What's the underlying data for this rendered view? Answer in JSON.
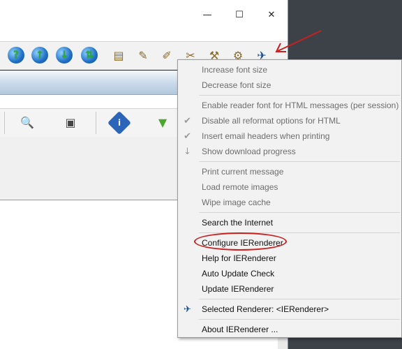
{
  "titlebar": {
    "minimize_glyph": "—",
    "maximize_glyph": "☐",
    "close_glyph": "✕"
  },
  "toolbar": {
    "globe_icons": [
      "globe-help-icon",
      "globe-up-icon",
      "globe-down-icon",
      "globe-sync-icon"
    ],
    "tool_icons": [
      "notes-icon",
      "edit-doc-icon",
      "doc-pen-icon",
      "wrench-scissors-icon",
      "tools-icon",
      "gear-tool-icon",
      "ierenderer-icon"
    ]
  },
  "toolbar_second": {
    "icons": [
      "search-doc-icon",
      "save-disk-icon",
      "info-icon",
      "filter-icon"
    ],
    "info_glyph": "i"
  },
  "context_menu": {
    "groups": [
      [
        {
          "label": "Increase font size",
          "checked": false,
          "disabled": true
        },
        {
          "label": "Decrease font size",
          "checked": false,
          "disabled": true
        }
      ],
      [
        {
          "label": "Enable reader font for HTML messages (per session)",
          "checked": false,
          "disabled": true
        },
        {
          "label": "Disable all reformat options for HTML",
          "checked": true,
          "disabled": true
        },
        {
          "label": "Insert email headers when printing",
          "checked": true,
          "disabled": true
        },
        {
          "label": "Show download progress",
          "checked": false,
          "disabled": true
        }
      ],
      [
        {
          "label": "Print current message",
          "checked": false,
          "disabled": true
        },
        {
          "label": "Load remote images",
          "checked": false,
          "disabled": true
        },
        {
          "label": "Wipe image cache",
          "checked": false,
          "disabled": true
        }
      ],
      [
        {
          "label": "Search the Internet",
          "checked": false,
          "disabled": false
        }
      ],
      [
        {
          "label": "Configure IERenderer",
          "checked": false,
          "disabled": false
        },
        {
          "label": "Help for IERenderer",
          "checked": false,
          "disabled": false
        },
        {
          "label": "Auto Update Check",
          "checked": false,
          "disabled": false
        },
        {
          "label": "Update IERenderer",
          "checked": false,
          "disabled": false
        }
      ],
      [
        {
          "label": "Selected Renderer: <IERenderer>",
          "checked": false,
          "disabled": false
        }
      ],
      [
        {
          "label": "About IERenderer ...",
          "checked": false,
          "disabled": false
        }
      ]
    ],
    "check_glyph": "✔",
    "download_glyph": "↓"
  },
  "colors": {
    "annotation_red": "#cc1f1f"
  }
}
